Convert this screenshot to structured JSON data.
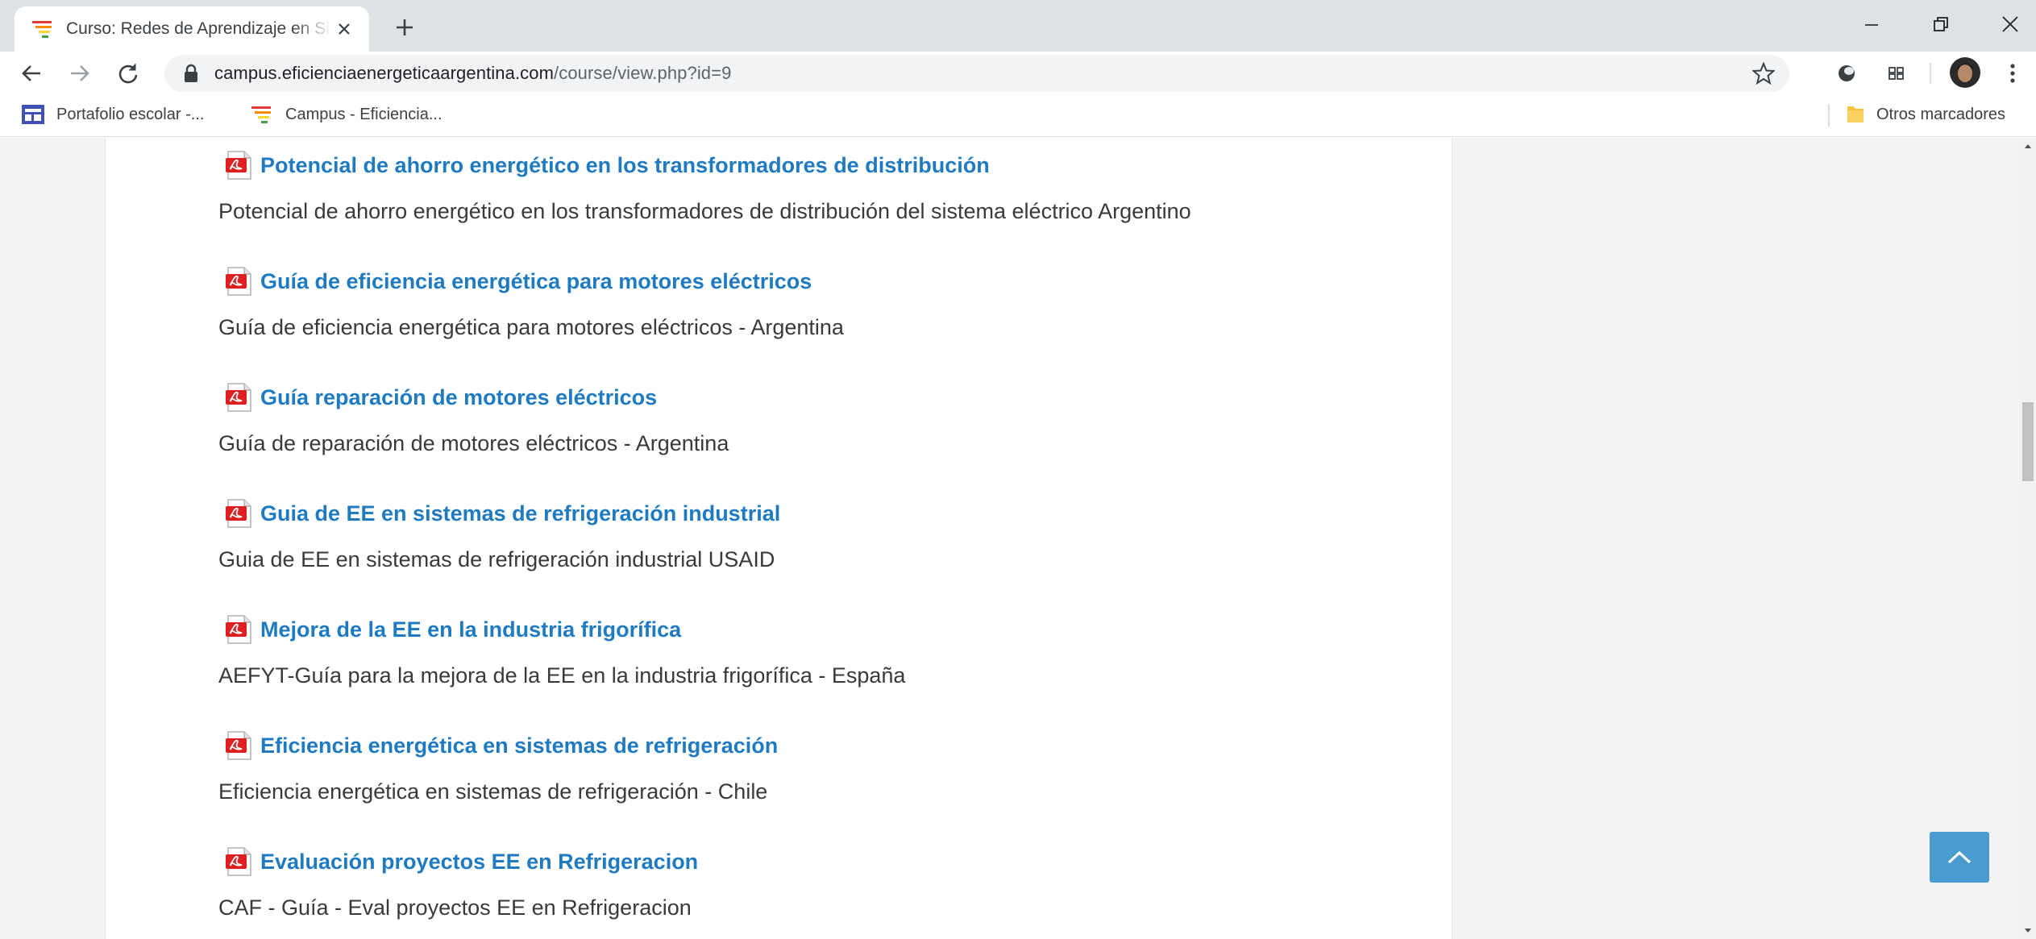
{
  "browser": {
    "tab_title": "Curso: Redes de Aprendizaje en Sistemas Eléctricos",
    "url_domain": "campus.eficienciaenergeticaargentina.com",
    "url_path": "/course/view.php?id=9",
    "bookmarks": [
      {
        "label": "Portafolio escolar -...",
        "icon": "classroom-icon"
      },
      {
        "label": "Campus - Eficiencia...",
        "icon": "campus-favicon"
      }
    ],
    "other_bookmarks": "Otros marcadores"
  },
  "activities": [
    {
      "title": "Potencial de ahorro energético en los transformadores de distribución",
      "description": "Potencial de ahorro energético en los transformadores de distribución del sistema eléctrico Argentino",
      "icon": "pdf-icon"
    },
    {
      "title": "Guía de eficiencia energética para motores eléctricos",
      "description": "Guía de eficiencia energética para motores eléctricos - Argentina",
      "icon": "pdf-icon"
    },
    {
      "title": "Guía reparación de motores eléctricos",
      "description": "Guía de reparación de motores eléctricos - Argentina",
      "icon": "pdf-icon"
    },
    {
      "title": "Guia de EE en sistemas de refrigeración industrial",
      "description": "Guia de EE en sistemas de refrigeración industrial USAID",
      "icon": "pdf-icon"
    },
    {
      "title": "Mejora de la EE en la industria frigorífica",
      "description": "AEFYT-Guía para la mejora de  la EE en la industria frigorífica - España",
      "icon": "pdf-icon"
    },
    {
      "title": "Eficiencia energética en sistemas de refrigeración",
      "description": "Eficiencia energética en sistemas de refrigeración - Chile",
      "icon": "pdf-icon"
    },
    {
      "title": "Evaluación proyectos EE en Refrigeracion",
      "description": "CAF - Guía - Eval proyectos EE en Refrigeracion",
      "icon": "pdf-icon"
    }
  ],
  "colors": {
    "link": "#1f7bc1",
    "text": "#373a3c",
    "page_bg": "#f2f3f4",
    "back_to_top": "#4a9bd0"
  }
}
